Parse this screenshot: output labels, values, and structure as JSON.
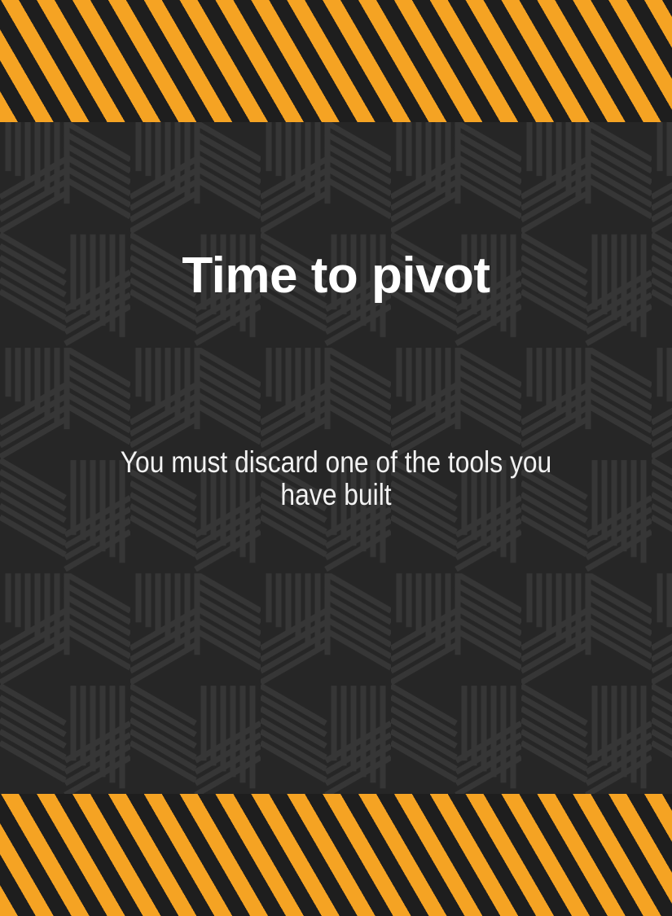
{
  "card": {
    "title": "Time to pivot",
    "message": "You must discard one of the tools you have built"
  },
  "colors": {
    "hazard_yellow": "#f5a323",
    "hazard_black": "#1e1e1e",
    "panel_background": "#262626",
    "pattern_stripe": "#363636",
    "text": "#ffffff"
  }
}
